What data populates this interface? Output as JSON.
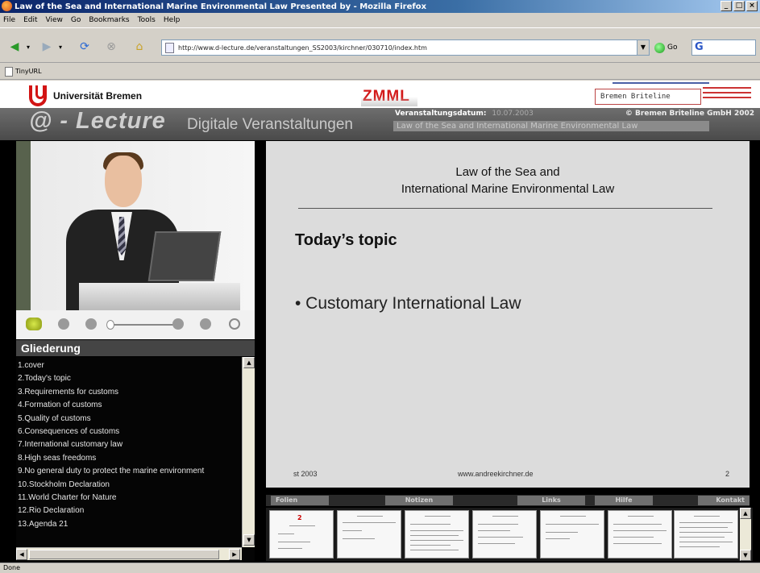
{
  "window": {
    "title": "Law of the Sea and International Marine Environmental Law Presented by - Mozilla Firefox",
    "controls": [
      "_",
      "□",
      "×"
    ]
  },
  "menubar": [
    "File",
    "Edit",
    "View",
    "Go",
    "Bookmarks",
    "Tools",
    "Help"
  ],
  "toolbar": {
    "url": "http://www.d-lecture.de/veranstaltungen_SS2003/kirchner/030710/index.htm",
    "go_label": "Go",
    "search_placeholder": ""
  },
  "bookmarks": [
    {
      "label": "TinyURL"
    }
  ],
  "header": {
    "university": "Universität Bremen",
    "zmml": "ZMML",
    "bremen_briteline": "Bremen Briteline",
    "lecture_brand": "@ - Lecture",
    "lecture_sub": "Digitale Veranstaltungen",
    "date_label": "Veranstaltungsdatum:",
    "date_value": "10.07.2003",
    "copyright": "© Bremen Briteline GmbH 2002",
    "lecture_name": "Law of the Sea and International Marine Environmental Law"
  },
  "gliederung": {
    "heading": "Gliederung",
    "items": [
      "1.cover",
      "2.Today's topic",
      "3.Requirements for customs",
      "4.Formation of customs",
      "5.Quality of customs",
      "6.Consequences of customs",
      "7.International customary law",
      "8.High seas freedoms",
      "9.No general duty to protect the marine environment",
      "10.Stockholm Declaration",
      "11.World Charter for Nature",
      "12.Rio Declaration",
      "13.Agenda 21"
    ]
  },
  "slide": {
    "title_line1": "Law of the Sea and",
    "title_line2": "International Marine Environmental Law",
    "topic": "Today’s topic",
    "bullet": "•  Customary International Law",
    "footer_left": "st 2003",
    "footer_mid": "www.andreekirchner.de",
    "footer_right": "2"
  },
  "tabs": [
    {
      "label": "Folien"
    },
    {
      "label": "Notizen"
    },
    {
      "label": "Links"
    },
    {
      "label": "Hilfe"
    },
    {
      "label": "Kontakt"
    }
  ],
  "thumbnails": {
    "count": 7,
    "first_number": "2"
  },
  "status": {
    "text": "Done"
  }
}
